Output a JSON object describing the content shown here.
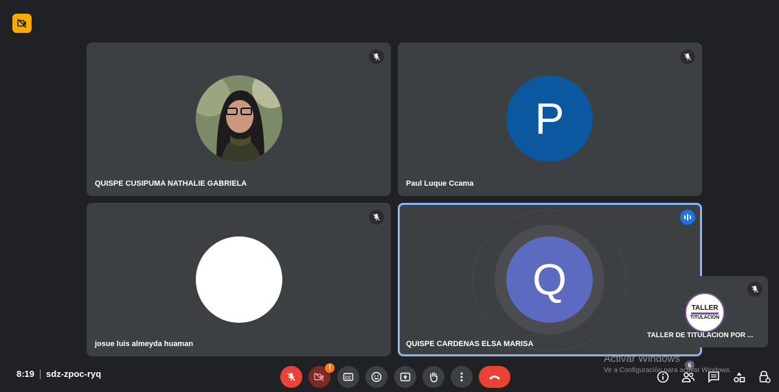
{
  "meeting": {
    "time": "8:19",
    "code": "sdz-zpoc-ryq"
  },
  "tiles": [
    {
      "name": "QUISPE CUSIPUMA NATHALIE GABRIELA",
      "avatar_letter": "",
      "avatar_color": "",
      "muted": true
    },
    {
      "name": "Paul Luque Ccama",
      "avatar_letter": "P",
      "avatar_color": "#0b57a0",
      "muted": true
    },
    {
      "name": "josue luis almeyda huaman",
      "avatar_letter": "",
      "avatar_color": "#ffffff",
      "muted": true
    },
    {
      "name": "QUISPE CARDENAS ELSA MARISA",
      "avatar_letter": "Q",
      "avatar_color": "#5c6bc0",
      "muted": false,
      "speaking": true
    }
  ],
  "self_view": {
    "name": "TALLER DE TITULACION POR ...",
    "logo_text": "TALLER",
    "logo_subtext": "TITULACION",
    "muted": true
  },
  "controls": {
    "camera_alert": "!",
    "participants_count": "6"
  },
  "watermark": {
    "line1": "Activar Windows",
    "line2": "Ve a Configuración para activar Windows."
  },
  "colors": {
    "background": "#202124",
    "tile": "#3c4043",
    "danger": "#ea4335",
    "accent": "#8ab4f8",
    "badge": "#f9ab00"
  },
  "icons": {
    "corner": "camera-off-icon",
    "mute": "mic-off-icon",
    "speaking": "audio-wave-icon"
  }
}
